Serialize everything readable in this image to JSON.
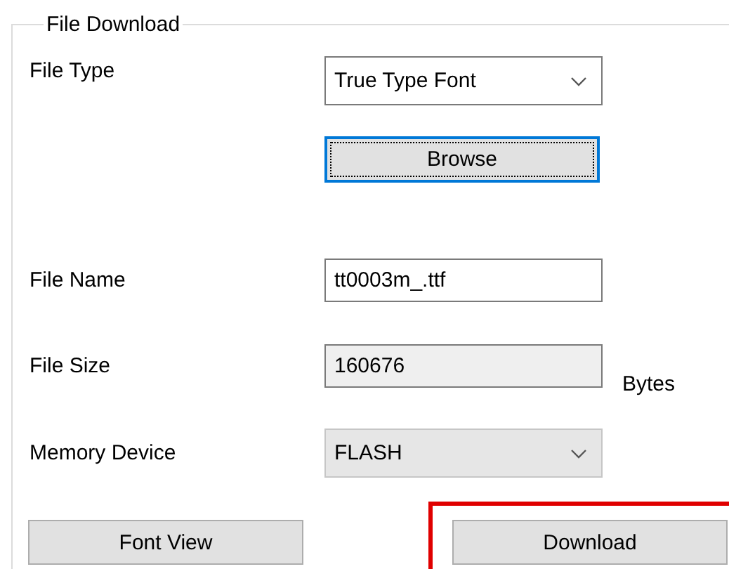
{
  "group_title": "File Download",
  "rows": [
    {
      "kind": "dropdown",
      "label": "File Type",
      "value": "True Type Font",
      "editable": true
    },
    {
      "kind": "button",
      "label": "Browse",
      "focused": true
    },
    {
      "kind": "spacer"
    },
    {
      "kind": "text",
      "label": "File Name",
      "value": "tt0003m_.ttf",
      "readonly": false
    },
    {
      "kind": "text",
      "label": "File Size",
      "value": "160676",
      "readonly": true,
      "unit": "Bytes"
    },
    {
      "kind": "dropdown",
      "label": "Memory Device",
      "value": "FLASH",
      "editable": false
    }
  ],
  "buttons": [
    {
      "label": "Font View",
      "highlighted": false
    },
    {
      "label": "Download",
      "highlighted": true
    }
  ]
}
